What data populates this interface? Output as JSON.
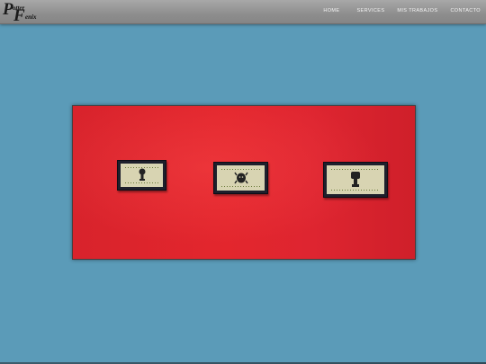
{
  "brand": {
    "logo_text": "PotterFenix",
    "logo_line1": "otter",
    "logo_line2": "enix",
    "logo_initial1": "P",
    "logo_initial2": "F"
  },
  "nav": {
    "items": [
      {
        "label": "HOME"
      },
      {
        "label": "SERVICES"
      },
      {
        "label": "MIS TRABAJOS"
      },
      {
        "label": "CONTACTO"
      }
    ]
  },
  "hero": {
    "image": "photo of three small black framed pictures on a red wall",
    "frames": [
      {
        "icon": "figure-icon"
      },
      {
        "icon": "creature-icon"
      },
      {
        "icon": "figure-icon"
      }
    ]
  },
  "colors": {
    "page_background": "#5b9bb8",
    "header": "#999999",
    "wall_red": "#e0252d",
    "frame": "#1e1f2c",
    "mat": "#d8d4b2"
  }
}
